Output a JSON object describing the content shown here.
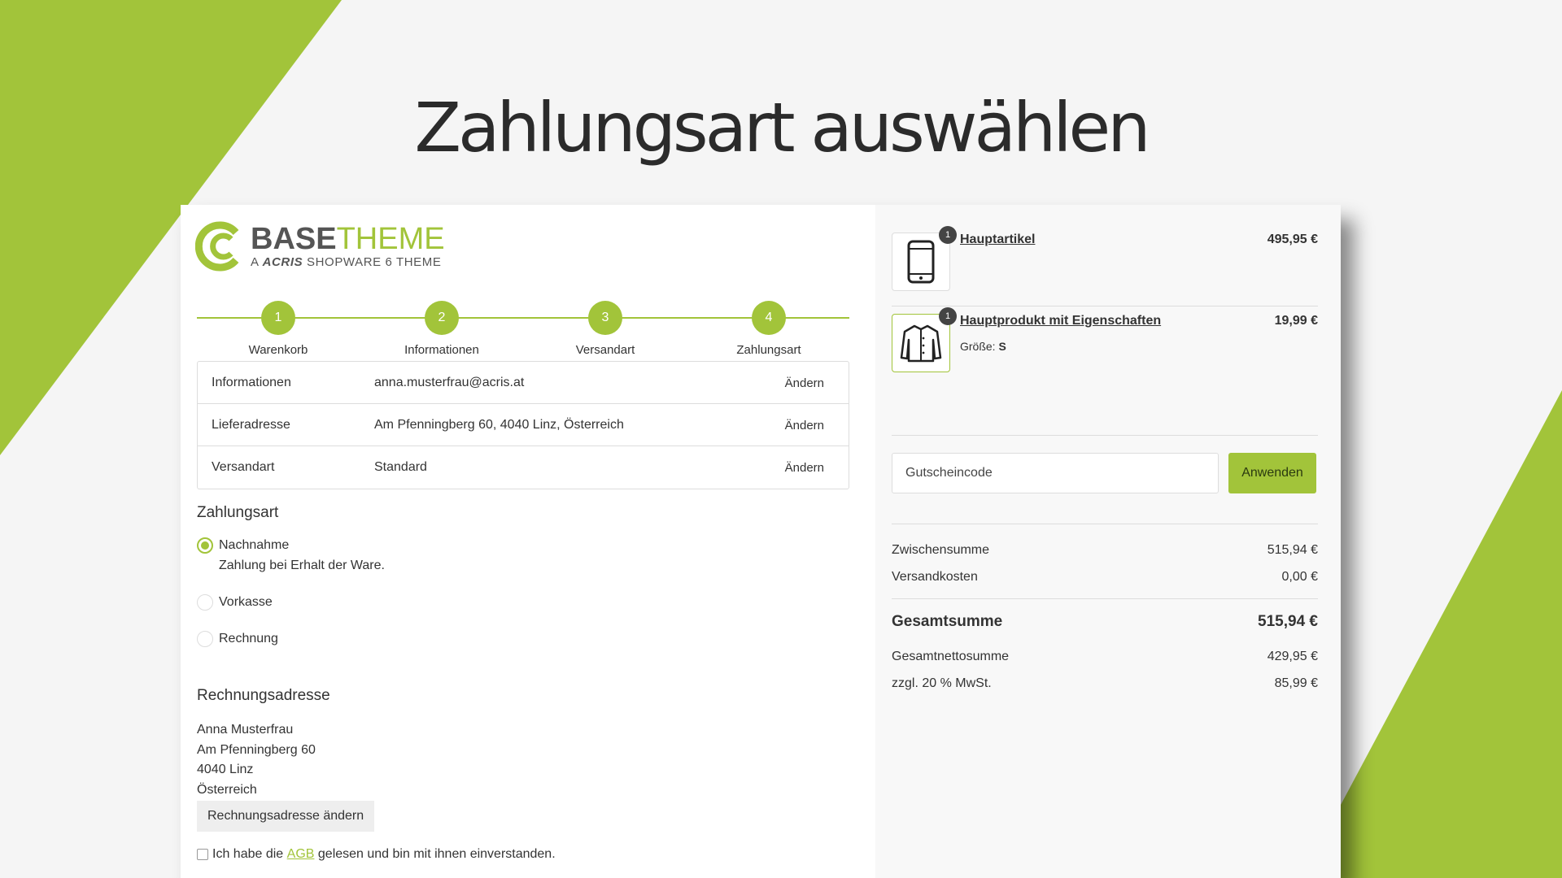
{
  "slide": {
    "title": "Zahlungsart auswählen"
  },
  "logo": {
    "brand_bold": "BASE",
    "brand_thin": "THEME",
    "tagline_prefix": "A",
    "tagline_brand": "ACRIS",
    "tagline_suffix": "SHOPWARE 6 THEME"
  },
  "steps": [
    {
      "number": "1",
      "label": "Warenkorb"
    },
    {
      "number": "2",
      "label": "Informationen"
    },
    {
      "number": "3",
      "label": "Versandart"
    },
    {
      "number": "4",
      "label": "Zahlungsart"
    }
  ],
  "summary": [
    {
      "key": "Informationen",
      "value": "anna.musterfrau@acris.at",
      "action": "Ändern"
    },
    {
      "key": "Lieferadresse",
      "value": "Am Pfenningberg 60, 4040 Linz, Österreich",
      "action": "Ändern"
    },
    {
      "key": "Versandart",
      "value": "Standard",
      "action": "Ändern"
    }
  ],
  "payment": {
    "heading": "Zahlungsart",
    "options": [
      {
        "label": "Nachnahme",
        "description": "Zahlung bei Erhalt der Ware.",
        "selected": true
      },
      {
        "label": "Vorkasse",
        "selected": false
      },
      {
        "label": "Rechnung",
        "selected": false
      }
    ]
  },
  "billing": {
    "heading": "Rechnungsadresse",
    "name": "Anna Musterfrau",
    "street": "Am Pfenningberg 60",
    "city": "4040 Linz",
    "country": "Österreich",
    "change_button": "Rechnungsadresse ändern"
  },
  "tos": {
    "prefix": "Ich habe die",
    "link": "AGB",
    "suffix": "gelesen und bin mit ihnen einverstanden."
  },
  "cart": {
    "items": [
      {
        "qty": "1",
        "name": "Hauptartikel",
        "price": "495,95 €",
        "icon": "smartphone-icon"
      },
      {
        "qty": "1",
        "name": "Hauptprodukt mit Eigenschaften",
        "price": "19,99 €",
        "prop_label": "Größe:",
        "prop_value": "S",
        "icon": "jacket-icon"
      }
    ],
    "voucher_placeholder": "Gutscheincode",
    "apply_label": "Anwenden",
    "totals": {
      "subtotal_label": "Zwischensumme",
      "subtotal": "515,94 €",
      "shipping_label": "Versandkosten",
      "shipping": "0,00 €",
      "grand_label": "Gesamtsumme",
      "grand": "515,94 €",
      "net_label": "Gesamtnettosumme",
      "net": "429,95 €",
      "tax_label": "zzgl. 20 % MwSt.",
      "tax": "85,99 €"
    }
  },
  "colors": {
    "accent": "#a2c43a",
    "text": "#333333",
    "border": "#dddddd"
  }
}
